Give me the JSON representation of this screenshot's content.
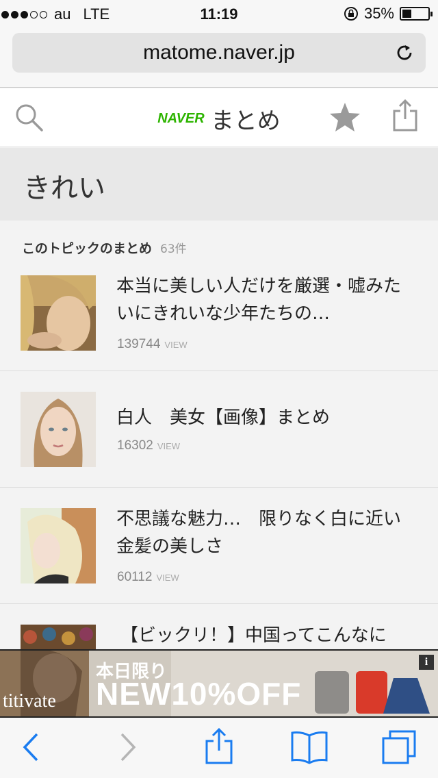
{
  "status_bar": {
    "signal_dots": [
      true,
      true,
      true,
      false,
      false
    ],
    "carrier": "au",
    "network": "LTE",
    "time": "11:19",
    "battery": "35%",
    "battery_level": 0.35
  },
  "url_bar": {
    "url": "matome.naver.jp"
  },
  "header": {
    "brand": "NAVER",
    "title": "まとめ"
  },
  "topic": {
    "title": "きれい"
  },
  "section": {
    "label": "このトピックのまとめ",
    "count": "63件"
  },
  "items": [
    {
      "title": "本当に美しい人だけを厳選・嘘みたいにきれいな少年たちの…",
      "views": "139744",
      "views_unit": "VIEW"
    },
    {
      "title": "白人　美女【画像】まとめ",
      "views": "16302",
      "views_unit": "VIEW"
    },
    {
      "title": "不思議な魅力…　限りなく白に近い金髪の美しさ",
      "views": "60112",
      "views_unit": "VIEW"
    },
    {
      "title": "【ビックリ！】中国ってこんなに",
      "views": "",
      "views_unit": ""
    }
  ],
  "ad": {
    "line1": "本日限り",
    "line2": "NEW10%OFF",
    "brand": "titivate",
    "info": "i"
  },
  "colors": {
    "naver_green": "#2db400",
    "ios_blue": "#1a7cf0"
  }
}
